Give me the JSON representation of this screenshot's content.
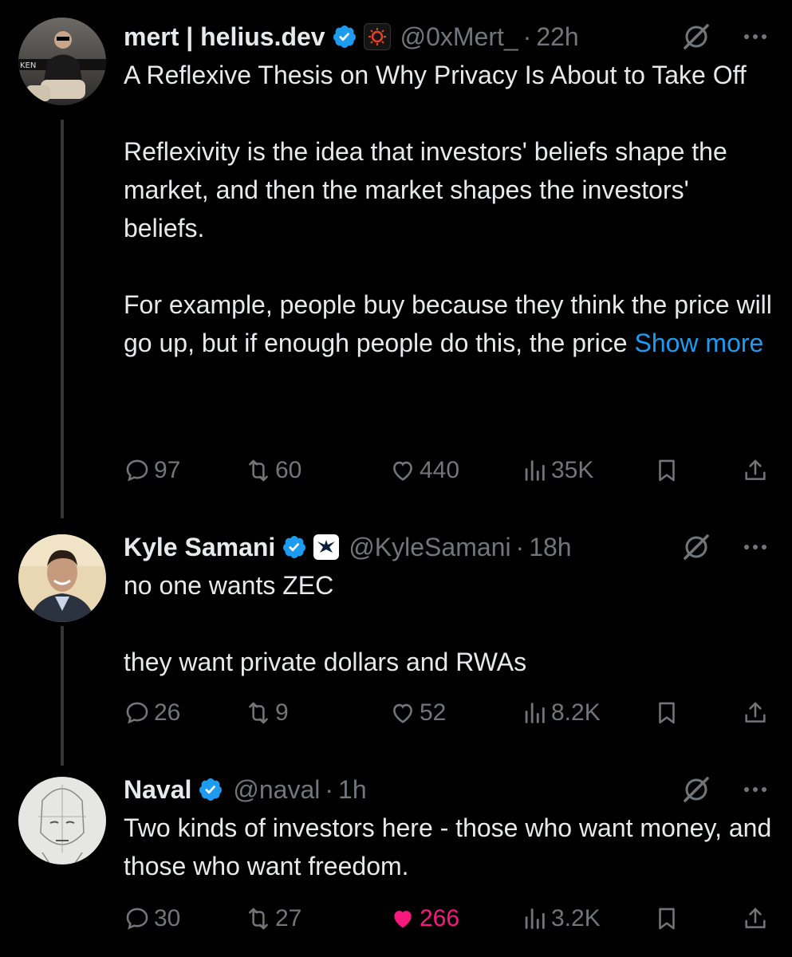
{
  "tweets": [
    {
      "name": "mert | helius.dev",
      "handle": "@0xMert_",
      "sep": "·",
      "time": "22h",
      "text": "A Reflexive Thesis on Why Privacy Is About to Take Off\n\nReflexivity is the idea that investors' beliefs shape the market, and then the market shapes the investors' beliefs.\n\nFor example, people buy because they think the price will go up, but if enough people do this, the price ",
      "show_more": "Show more",
      "replies": "97",
      "reposts": "60",
      "likes": "440",
      "views": "35K",
      "liked": false
    },
    {
      "name": "Kyle Samani",
      "handle": "@KyleSamani",
      "sep": "·",
      "time": "18h",
      "text": "no one wants ZEC\n\nthey want private dollars and RWAs",
      "replies": "26",
      "reposts": "9",
      "likes": "52",
      "views": "8.2K",
      "liked": false
    },
    {
      "name": "Naval",
      "handle": "@naval",
      "sep": "·",
      "time": "1h",
      "text": "Two kinds of investors here - those who want money, and those who want freedom.",
      "replies": "30",
      "reposts": "27",
      "likes": "266",
      "views": "3.2K",
      "liked": true
    }
  ],
  "colors": {
    "background": "#000000",
    "text": "#e7e9ea",
    "muted": "#71767b",
    "link": "#1d9bf0",
    "like": "#f91880",
    "verified": "#1d9bf0"
  },
  "icons": [
    "verified-badge-icon",
    "grok-icon",
    "more-icon",
    "reply-icon",
    "repost-icon",
    "like-icon",
    "views-icon",
    "bookmark-icon",
    "share-icon"
  ]
}
